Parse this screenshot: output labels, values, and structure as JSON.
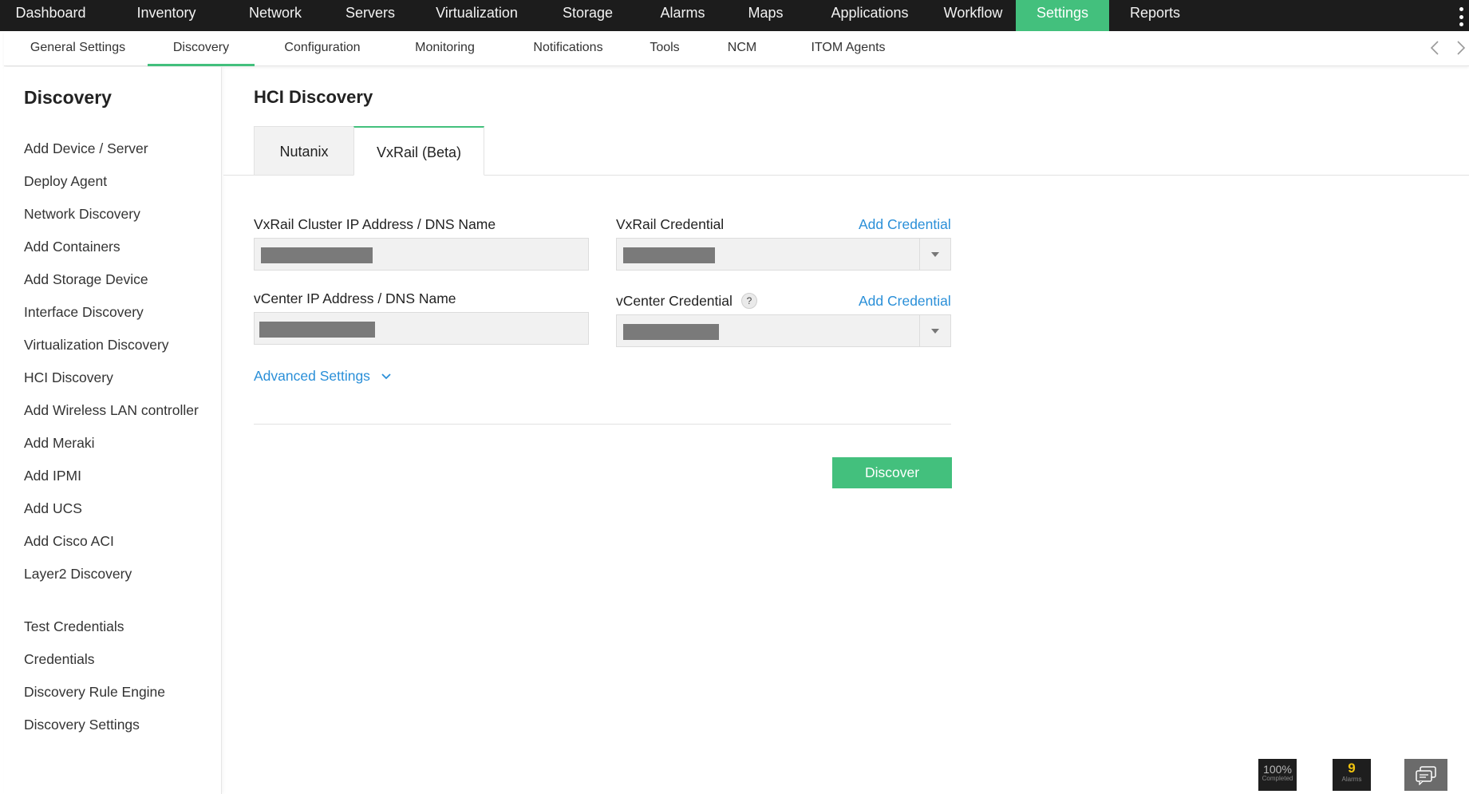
{
  "topnav": {
    "items": [
      {
        "label": "Dashboard"
      },
      {
        "label": "Inventory"
      },
      {
        "label": "Network"
      },
      {
        "label": "Servers"
      },
      {
        "label": "Virtualization"
      },
      {
        "label": "Storage"
      },
      {
        "label": "Alarms"
      },
      {
        "label": "Maps"
      },
      {
        "label": "Applications"
      },
      {
        "label": "Workflow"
      },
      {
        "label": "Settings"
      },
      {
        "label": "Reports"
      }
    ],
    "active": "Settings",
    "menu_icon": "kebab-menu-icon"
  },
  "subnav": {
    "items": [
      {
        "label": "General Settings"
      },
      {
        "label": "Discovery"
      },
      {
        "label": "Configuration"
      },
      {
        "label": "Monitoring"
      },
      {
        "label": "Notifications"
      },
      {
        "label": "Tools"
      },
      {
        "label": "NCM"
      },
      {
        "label": "ITOM Agents"
      }
    ],
    "active": "Discovery",
    "prev_icon": "chevron-left-icon",
    "next_icon": "chevron-right-icon"
  },
  "sidebar": {
    "title": "Discovery",
    "links": [
      {
        "label": "Add Device / Server"
      },
      {
        "label": "Deploy Agent"
      },
      {
        "label": "Network Discovery"
      },
      {
        "label": "Add Containers"
      },
      {
        "label": "Add Storage Device"
      },
      {
        "label": "Interface Discovery"
      },
      {
        "label": "Virtualization Discovery"
      },
      {
        "label": "HCI Discovery"
      },
      {
        "label": "Add Wireless LAN controller"
      },
      {
        "label": "Add Meraki"
      },
      {
        "label": "Add IPMI"
      },
      {
        "label": "Add UCS"
      },
      {
        "label": "Add Cisco ACI"
      },
      {
        "label": "Layer2 Discovery"
      }
    ],
    "links2": [
      {
        "label": "Test Credentials"
      },
      {
        "label": "Credentials"
      },
      {
        "label": "Discovery Rule Engine"
      },
      {
        "label": "Discovery Settings"
      }
    ]
  },
  "main": {
    "title": "HCI Discovery",
    "tabs": [
      {
        "label": "Nutanix"
      },
      {
        "label": "VxRail (Beta)"
      }
    ],
    "active_tab": "VxRail (Beta)",
    "form": {
      "cluster_label": "VxRail Cluster IP Address / DNS Name",
      "cluster_value": "",
      "vxrail_cred_label": "VxRail Credential",
      "vxrail_add_cred": "Add Credential",
      "vcenter_label": "vCenter IP Address / DNS Name",
      "vcenter_value": "",
      "vcenter_cred_label": "vCenter Credential",
      "vcenter_help": "?",
      "vcenter_add_cred": "Add Credential",
      "advanced_settings": "Advanced Settings",
      "discover_button": "Discover"
    }
  },
  "status": {
    "progress_value": "100%",
    "progress_label": "Completed",
    "alarms_count": "9",
    "alarms_label": "Alarms",
    "chat_icon": "chat-icon"
  },
  "colors": {
    "accent": "#43c07d",
    "link": "#2a8fd8",
    "topbar": "#1c1c1c",
    "alarm_count": "#f1c40f"
  }
}
